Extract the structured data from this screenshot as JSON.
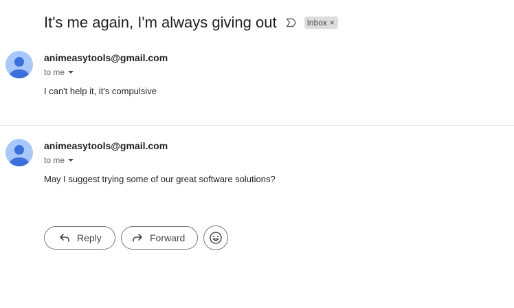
{
  "thread": {
    "subject": "It's me again, I'm always giving out",
    "label_icon": "label-importance-icon",
    "label_chip": "Inbox",
    "label_chip_remove": "×"
  },
  "messages": [
    {
      "sender": "animeasytools@gmail.com",
      "recipient": "to me",
      "body": "I can't help it, it's compulsive",
      "avatar_icon": "default-person-avatar"
    },
    {
      "sender": "animeasytools@gmail.com",
      "recipient": "to me",
      "body": "May I suggest trying some of our great software solutions?",
      "avatar_icon": "default-person-avatar"
    }
  ],
  "actions": {
    "reply_label": "Reply",
    "forward_label": "Forward",
    "emoji_icon": "add-reaction-icon"
  },
  "colors": {
    "avatar_bg": "#a8c7fa",
    "avatar_fg": "#3b6fd9",
    "chip_bg": "#dddddd",
    "border": "#747775"
  }
}
